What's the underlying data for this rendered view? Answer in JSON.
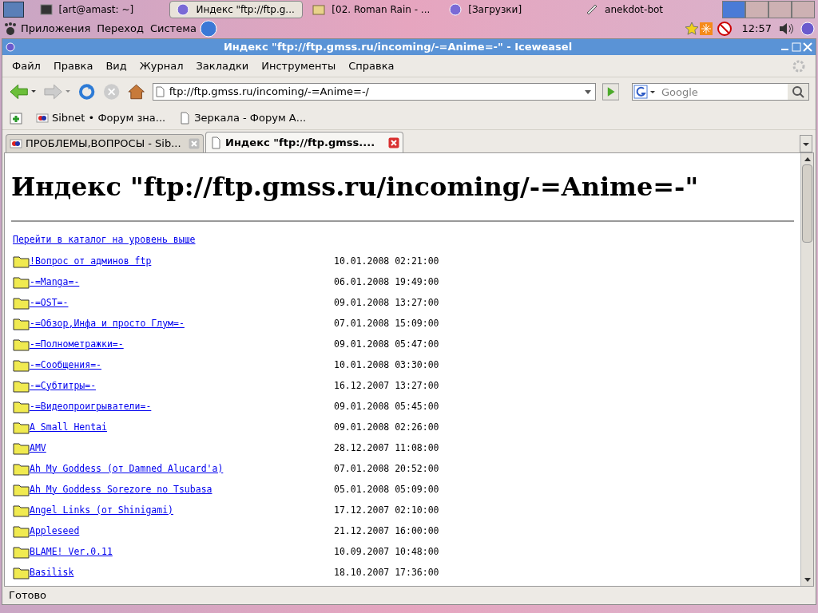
{
  "taskbar": {
    "tasks": [
      {
        "label": "[art@amast: ~]",
        "kind": "terminal",
        "selected": false
      },
      {
        "label": "Индекс \"ftp://ftp.g...",
        "kind": "browser",
        "selected": true
      },
      {
        "label": "[02. Roman Rain - ...",
        "kind": "player",
        "selected": false
      },
      {
        "label": "[Загрузки]",
        "kind": "browser",
        "selected": false
      },
      {
        "label": "anekdot-bot",
        "kind": "bot",
        "selected": false
      }
    ],
    "workspaces": [
      {
        "selected": true
      },
      {
        "selected": false
      },
      {
        "selected": false
      },
      {
        "selected": false
      }
    ]
  },
  "panel": {
    "menus": [
      "Приложения",
      "Переход",
      "Система"
    ],
    "clock": "12:57"
  },
  "window": {
    "title": "Индекс \"ftp://ftp.gmss.ru/incoming/-=Anime=-\" - Iceweasel"
  },
  "menu_bar": [
    "Файл",
    "Правка",
    "Вид",
    "Журнал",
    "Закладки",
    "Инструменты",
    "Справка"
  ],
  "address_bar": {
    "value": "ftp://ftp.gmss.ru/incoming/-=Anime=-/"
  },
  "search": {
    "placeholder": "Google"
  },
  "bookmarks": [
    {
      "label": "Sibnet • Форум зна...",
      "kind": "site"
    },
    {
      "label": "Зеркала - Форум А...",
      "kind": "page"
    }
  ],
  "tabs": [
    {
      "label": "ПРОБЛЕМЫ,ВОПРОСЫ - Sib...",
      "kind": "site",
      "selected": false
    },
    {
      "label": "Индекс \"ftp://ftp.gmss....",
      "kind": "page",
      "selected": true
    }
  ],
  "page": {
    "heading": "Индекс \"ftp://ftp.gmss.ru/incoming/-=Anime=-\"",
    "parent_link": "Перейти в каталог на уровень выше",
    "entries": [
      {
        "name": "!Вопрос от админов ftp",
        "date": "10.01.2008 02:21:00"
      },
      {
        "name": "-=Manga=-",
        "date": "06.01.2008 19:49:00"
      },
      {
        "name": "-=OST=-",
        "date": "09.01.2008 13:27:00"
      },
      {
        "name": "-=Обзор,Инфа и просто Глум=-",
        "date": "07.01.2008 15:09:00"
      },
      {
        "name": "-=Полнометражки=-",
        "date": "09.01.2008 05:47:00"
      },
      {
        "name": "-=Сообщения=-",
        "date": "10.01.2008 03:30:00"
      },
      {
        "name": "-=Субтитры=-",
        "date": "16.12.2007 13:27:00"
      },
      {
        "name": "-=Видеопроигрыватели=-",
        "date": "09.01.2008 05:45:00"
      },
      {
        "name": "A Small Hentai",
        "date": "09.01.2008 02:26:00"
      },
      {
        "name": "AMV",
        "date": "28.12.2007 11:08:00"
      },
      {
        "name": "Ah My Goddess (от Damned Alucard'a)",
        "date": "07.01.2008 20:52:00"
      },
      {
        "name": "Ah My Goddess Sorezore no Tsubasa",
        "date": "05.01.2008 05:09:00"
      },
      {
        "name": "Angel Links (от Shinigami)",
        "date": "17.12.2007 02:10:00"
      },
      {
        "name": "Appleseed",
        "date": "21.12.2007 16:00:00"
      },
      {
        "name": "BLAME! Ver.0.11",
        "date": "10.09.2007 10:48:00"
      },
      {
        "name": "Basilisk",
        "date": "18.10.2007 17:36:00"
      }
    ]
  },
  "status_bar": "Готово"
}
